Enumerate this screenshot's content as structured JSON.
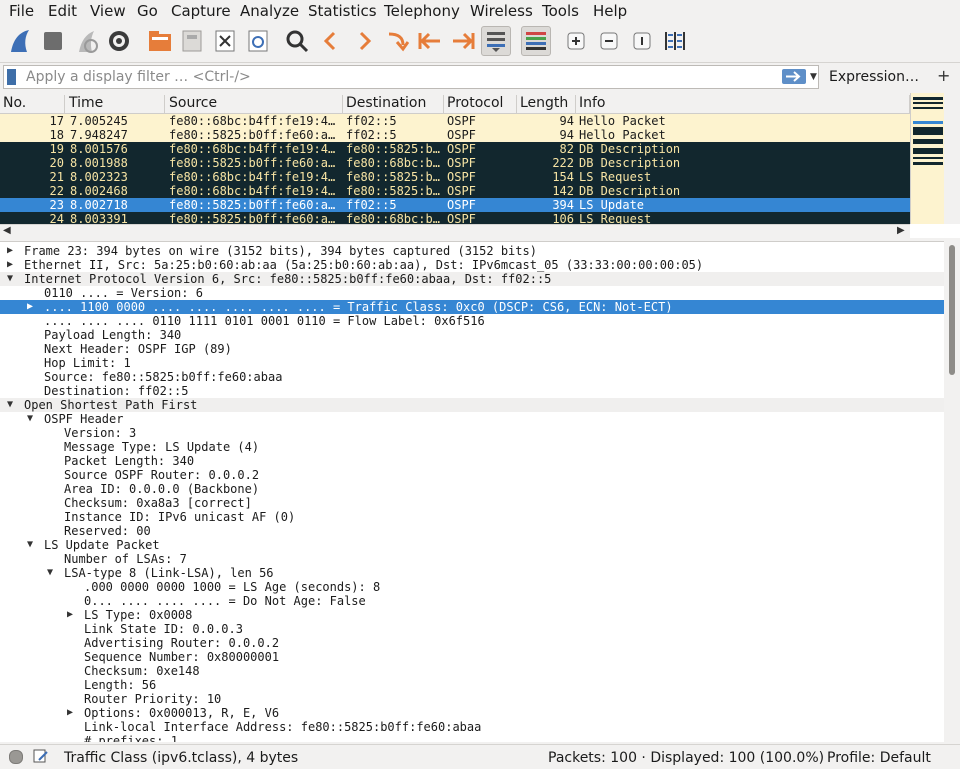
{
  "menu": [
    "File",
    "Edit",
    "View",
    "Go",
    "Capture",
    "Analyze",
    "Statistics",
    "Telephony",
    "Wireless",
    "Tools",
    "Help"
  ],
  "filter": {
    "placeholder": "Apply a display filter … <Ctrl-/>",
    "expression_label": "Expression…",
    "add_label": "+"
  },
  "packet_list": {
    "columns": [
      "No.",
      "Time",
      "Source",
      "Destination",
      "Protocol",
      "Length",
      "Info"
    ],
    "rows": [
      {
        "no": "17",
        "time": "7.005245",
        "src": "fe80::68bc:b4ff:fe19:4…",
        "dst": "ff02::5",
        "proto": "OSPF",
        "len": "94",
        "info": "Hello Packet",
        "style": "hello"
      },
      {
        "no": "18",
        "time": "7.948247",
        "src": "fe80::5825:b0ff:fe60:a…",
        "dst": "ff02::5",
        "proto": "OSPF",
        "len": "94",
        "info": "Hello Packet",
        "style": "hello"
      },
      {
        "no": "19",
        "time": "8.001576",
        "src": "fe80::68bc:b4ff:fe19:4…",
        "dst": "fe80::5825:b…",
        "proto": "OSPF",
        "len": "82",
        "info": "DB Description",
        "style": "dark"
      },
      {
        "no": "20",
        "time": "8.001988",
        "src": "fe80::5825:b0ff:fe60:a…",
        "dst": "fe80::68bc:b…",
        "proto": "OSPF",
        "len": "222",
        "info": "DB Description",
        "style": "dark"
      },
      {
        "no": "21",
        "time": "8.002323",
        "src": "fe80::68bc:b4ff:fe19:4…",
        "dst": "fe80::5825:b…",
        "proto": "OSPF",
        "len": "154",
        "info": "LS Request",
        "style": "dark"
      },
      {
        "no": "22",
        "time": "8.002468",
        "src": "fe80::68bc:b4ff:fe19:4…",
        "dst": "fe80::5825:b…",
        "proto": "OSPF",
        "len": "142",
        "info": "DB Description",
        "style": "dark"
      },
      {
        "no": "23",
        "time": "8.002718",
        "src": "fe80::5825:b0ff:fe60:a…",
        "dst": "ff02::5",
        "proto": "OSPF",
        "len": "394",
        "info": "LS Update",
        "style": "selected"
      },
      {
        "no": "24",
        "time": "8.003391",
        "src": "fe80::5825:b0ff:fe60:a…",
        "dst": "fe80::68bc:b…",
        "proto": "OSPF",
        "len": "106",
        "info": "LS Request",
        "style": "dark"
      }
    ]
  },
  "detail": [
    {
      "text": "Frame 23: 394 bytes on wire (3152 bits), 394 bytes captured (3152 bits)",
      "indent": 0,
      "arrow": "right"
    },
    {
      "text": "Ethernet II, Src: 5a:25:b0:60:ab:aa (5a:25:b0:60:ab:aa), Dst: IPv6mcast_05 (33:33:00:00:00:05)",
      "indent": 0,
      "arrow": "right"
    },
    {
      "text": "Internet Protocol Version 6, Src: fe80::5825:b0ff:fe60:abaa, Dst: ff02::5",
      "indent": 0,
      "arrow": "down",
      "band": true
    },
    {
      "text": "0110 .... = Version: 6",
      "indent": 1,
      "arrow": ""
    },
    {
      "text": ".... 1100 0000 .... .... .... .... .... = Traffic Class: 0xc0 (DSCP: CS6, ECN: Not-ECT)",
      "indent": 1,
      "arrow": "right",
      "selected": true
    },
    {
      "text": ".... .... .... 0110 1111 0101 0001 0110 = Flow Label: 0x6f516",
      "indent": 1,
      "arrow": ""
    },
    {
      "text": "Payload Length: 340",
      "indent": 1,
      "arrow": ""
    },
    {
      "text": "Next Header: OSPF IGP (89)",
      "indent": 1,
      "arrow": ""
    },
    {
      "text": "Hop Limit: 1",
      "indent": 1,
      "arrow": ""
    },
    {
      "text": "Source: fe80::5825:b0ff:fe60:abaa",
      "indent": 1,
      "arrow": ""
    },
    {
      "text": "Destination: ff02::5",
      "indent": 1,
      "arrow": ""
    },
    {
      "text": "Open Shortest Path First",
      "indent": 0,
      "arrow": "down",
      "band": true
    },
    {
      "text": "OSPF Header",
      "indent": 1,
      "arrow": "down"
    },
    {
      "text": "Version: 3",
      "indent": 2,
      "arrow": ""
    },
    {
      "text": "Message Type: LS Update (4)",
      "indent": 2,
      "arrow": ""
    },
    {
      "text": "Packet Length: 340",
      "indent": 2,
      "arrow": ""
    },
    {
      "text": "Source OSPF Router: 0.0.0.2",
      "indent": 2,
      "arrow": ""
    },
    {
      "text": "Area ID: 0.0.0.0 (Backbone)",
      "indent": 2,
      "arrow": ""
    },
    {
      "text": "Checksum: 0xa8a3 [correct]",
      "indent": 2,
      "arrow": ""
    },
    {
      "text": "Instance ID: IPv6 unicast AF (0)",
      "indent": 2,
      "arrow": ""
    },
    {
      "text": "Reserved: 00",
      "indent": 2,
      "arrow": ""
    },
    {
      "text": "LS Update Packet",
      "indent": 1,
      "arrow": "down"
    },
    {
      "text": "Number of LSAs: 7",
      "indent": 2,
      "arrow": ""
    },
    {
      "text": "LSA-type 8 (Link-LSA), len 56",
      "indent": 2,
      "arrow": "down"
    },
    {
      "text": ".000 0000 0000 1000 = LS Age (seconds): 8",
      "indent": 3,
      "arrow": ""
    },
    {
      "text": "0... .... .... .... = Do Not Age: False",
      "indent": 3,
      "arrow": ""
    },
    {
      "text": "LS Type: 0x0008",
      "indent": 3,
      "arrow": "right"
    },
    {
      "text": "Link State ID: 0.0.0.3",
      "indent": 3,
      "arrow": ""
    },
    {
      "text": "Advertising Router: 0.0.0.2",
      "indent": 3,
      "arrow": ""
    },
    {
      "text": "Sequence Number: 0x80000001",
      "indent": 3,
      "arrow": ""
    },
    {
      "text": "Checksum: 0xe148",
      "indent": 3,
      "arrow": ""
    },
    {
      "text": "Length: 56",
      "indent": 3,
      "arrow": ""
    },
    {
      "text": "Router Priority: 10",
      "indent": 3,
      "arrow": ""
    },
    {
      "text": "Options: 0x000013, R, E, V6",
      "indent": 3,
      "arrow": "right"
    },
    {
      "text": "Link-local Interface Address: fe80::5825:b0ff:fe60:abaa",
      "indent": 3,
      "arrow": ""
    },
    {
      "text": "# prefixes: 1",
      "indent": 3,
      "arrow": ""
    }
  ],
  "status": {
    "field_info": "Traffic Class (ipv6.tclass), 4 bytes",
    "packets": "Packets: 100 · Displayed: 100 (100.0%)",
    "profile": "Profile: Default"
  },
  "colors": {
    "hello_bg": "#fdf3cf",
    "dark_bg": "#12272e",
    "dark_fg": "#f7e4a4",
    "selected_bg": "#3586d3",
    "band_bg": "#f0efee"
  }
}
